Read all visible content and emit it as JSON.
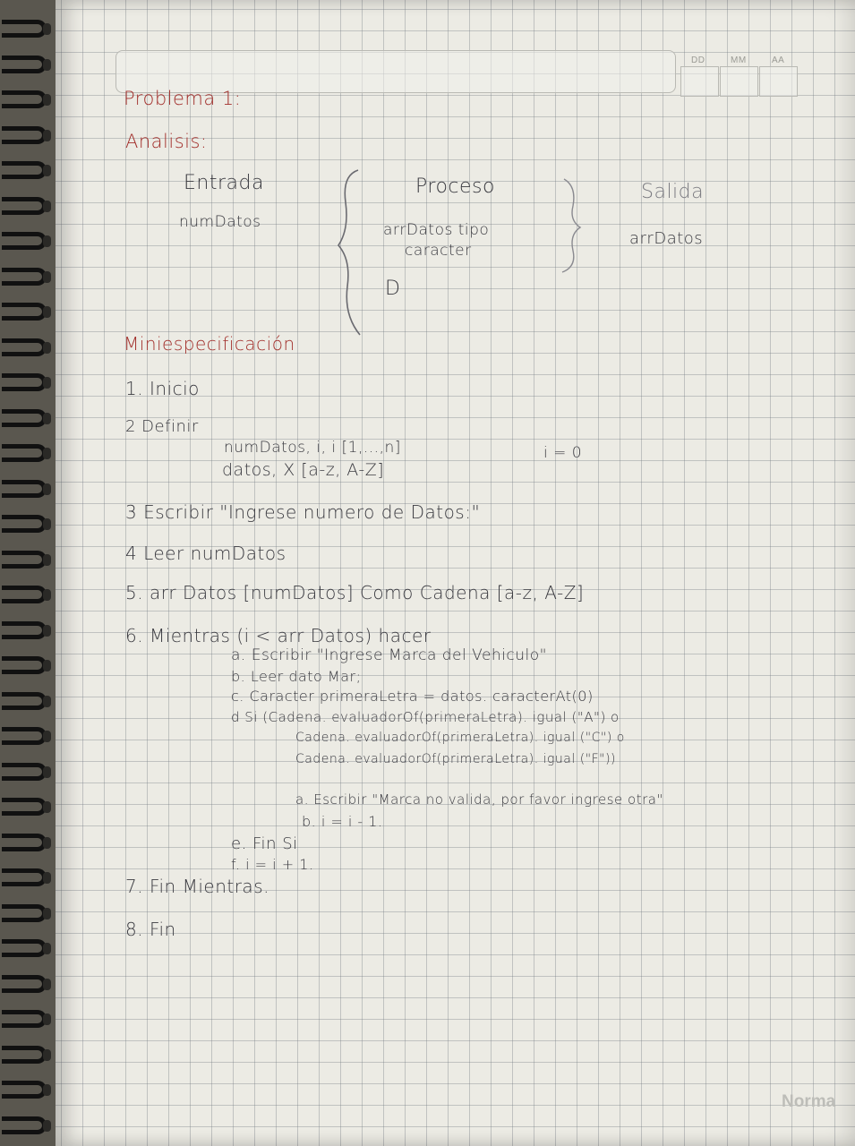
{
  "header": {
    "dd": "DD",
    "mm": "MM",
    "aa": "AA"
  },
  "title": "Problema 1:",
  "analysis": {
    "heading": "Analisis:",
    "entrada_label": "Entrada",
    "entrada_value": "numDatos",
    "proceso_label": "Proceso",
    "proceso_line1": "arrDatos tipo",
    "proceso_line2": "caracter",
    "proceso_mark": "D",
    "salida_label": "Salida",
    "salida_value": "arrDatos"
  },
  "miniespec": {
    "heading": "Miniespecificación",
    "lines": [
      "1. Inicio",
      "2 Definir",
      "numDatos, i, i [1,...,n]",
      "i = 0",
      "datos, X [a-z, A-Z]",
      "3 Escribir \"Ingrese numero de Datos:\"",
      "4 Leer numDatos",
      "5. arr Datos [numDatos] Como Cadena [a-z, A-Z]",
      "6. Mientras (i < arr Datos) hacer",
      "a. Escribir \"Ingrese Marca del Vehiculo\"",
      "b. Leer dato Mar;",
      "c. Caracter primeraLetra = datos. caracterAt(0)",
      "d Si (Cadena. evaluadorOf(primeraLetra). igual (\"A\") o",
      "Cadena. evaluadorOf(primeraLetra). igual (\"C\") o",
      "Cadena. evaluadorOf(primeraLetra). igual (\"F\"))",
      "a. Escribir \"Marca no valida, por favor ingrese otra\"",
      "b. i = i - 1.",
      "e. Fin Si",
      "f. i = i + 1.",
      "7. Fin Mientras.",
      "8. Fin"
    ]
  },
  "brand": "Norma",
  "colors": {
    "paper": "#ecebe4",
    "grid": "#787d87",
    "red_ink": "#a22f2b",
    "pencil": "#3a3a40",
    "ring": "#111111"
  }
}
